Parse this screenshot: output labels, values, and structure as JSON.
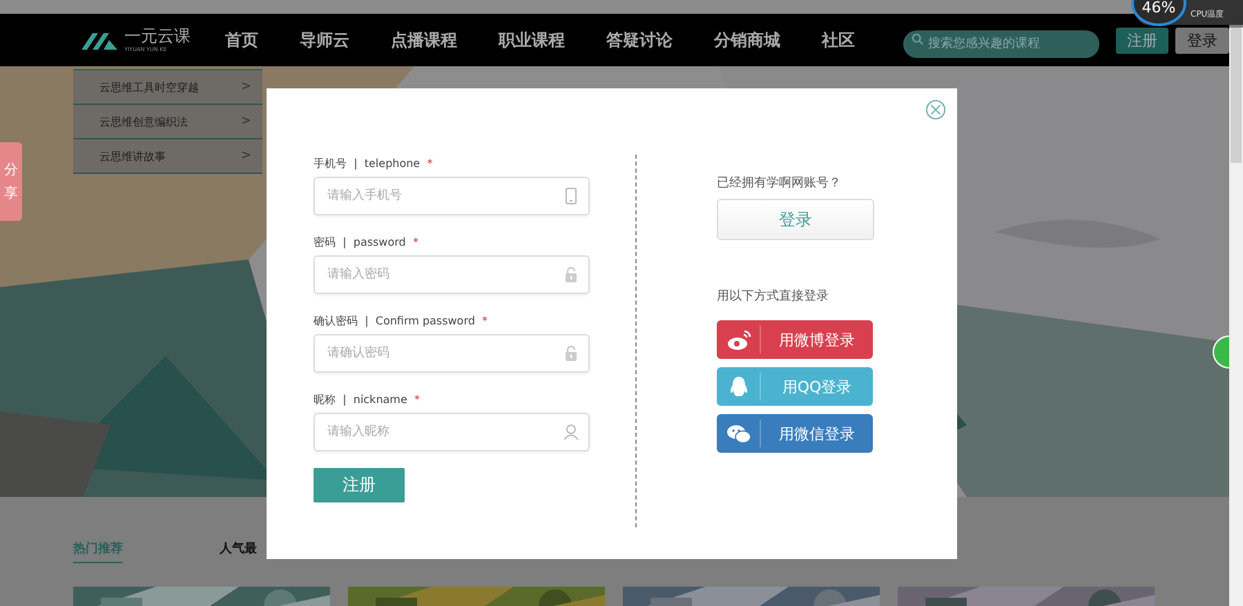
{
  "top_bar": {
    "logo": {
      "title": "一元云课",
      "subtitle": "YIYUAN YUN KE"
    },
    "nav": [
      {
        "label": "首页"
      },
      {
        "label": "导师云"
      },
      {
        "label": "点播课程"
      },
      {
        "label": "职业课程"
      },
      {
        "label": "答疑讨论"
      },
      {
        "label": "分销商城"
      },
      {
        "label": "社区"
      }
    ],
    "search": {
      "placeholder": "搜索您感兴趣的课程"
    },
    "buttons": [
      {
        "label": "注册",
        "kind": "primary"
      },
      {
        "label": "登录",
        "kind": "secondary"
      }
    ]
  },
  "cpu_widget": {
    "value": "46%",
    "label": "CPU温度"
  },
  "side_menu": [
    {
      "label": "云思维工具时空穿越",
      "arrow": ">"
    },
    {
      "label": "云思维创意编织法",
      "arrow": ">"
    },
    {
      "label": "云思维讲故事",
      "arrow": ">"
    }
  ],
  "share_tab": "分享",
  "tabs": [
    {
      "label": "热门推荐",
      "selected": true
    },
    {
      "label": "人气最",
      "selected": false
    }
  ],
  "modal": {
    "fields": [
      {
        "label": "手机号",
        "separator": "|",
        "hint": "telephone",
        "required_mark": "*",
        "placeholder": "请输入手机号",
        "kind": "phone"
      },
      {
        "label": "密码",
        "separator": "|",
        "hint": "password",
        "required_mark": "*",
        "placeholder": "请输入密码",
        "kind": "password"
      },
      {
        "label": "确认密码",
        "separator": "|",
        "hint": "Confirm password",
        "required_mark": "*",
        "placeholder": "请确认密码",
        "kind": "password"
      },
      {
        "label": "昵称",
        "separator": "|",
        "hint": "nickname",
        "required_mark": "*",
        "placeholder": "请输入昵称",
        "kind": "name"
      }
    ],
    "submit": "注册",
    "have_account": "已经拥有学啊网账号？",
    "login_button": "登录",
    "social_title": "用以下方式直接登录",
    "social": [
      {
        "label": "用微博登录",
        "kind": "weibo",
        "color": "#d8404f"
      },
      {
        "label": "用QQ登录",
        "kind": "qq",
        "color": "#4bb3cf"
      },
      {
        "label": "用微信登录",
        "kind": "wechat",
        "color": "#3a7dbd"
      }
    ]
  }
}
